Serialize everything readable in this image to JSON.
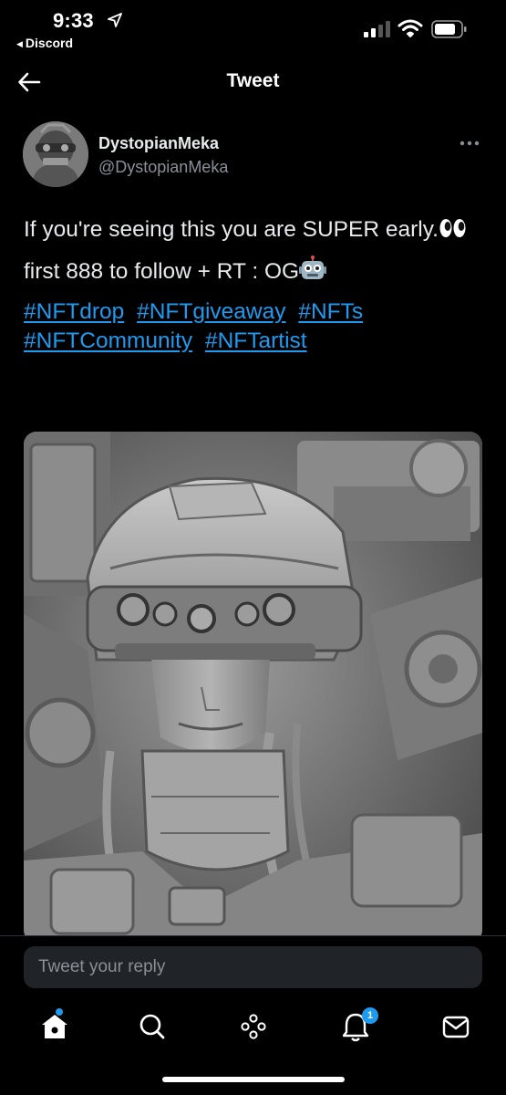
{
  "status_bar": {
    "time": "9:33",
    "back_app_label": "Discord",
    "icons": [
      "location-arrow-icon",
      "cellular-signal-icon",
      "wifi-icon",
      "battery-icon"
    ]
  },
  "header": {
    "title": "Tweet",
    "back_icon": "back-arrow-icon"
  },
  "tweet": {
    "author": {
      "display_name": "DystopianMeka",
      "handle": "@DystopianMeka"
    },
    "more_icon": "more-horizontal-icon",
    "text_line1": "If you're seeing this you are SUPER early.",
    "text_line1_emoji": "eyes-emoji",
    "text_line2": "first 888 to follow + RT : OG",
    "text_line2_emoji": "robot-emoji",
    "hashtags": [
      "#NFTdrop",
      "#NFTgiveaway",
      "#NFTs",
      "#NFTCommunity",
      "#NFTartist"
    ],
    "media": "robot-soldier-image"
  },
  "reply": {
    "placeholder": "Tweet your reply"
  },
  "tab_bar": {
    "tabs": [
      "home-icon",
      "search-icon",
      "spaces-icon",
      "notifications-icon",
      "messages-icon"
    ],
    "notifications_badge": "1"
  },
  "colors": {
    "background": "#000000",
    "accent": "#1d9bf0",
    "text": "#e7e9ea",
    "secondary_text": "#8b9096"
  }
}
